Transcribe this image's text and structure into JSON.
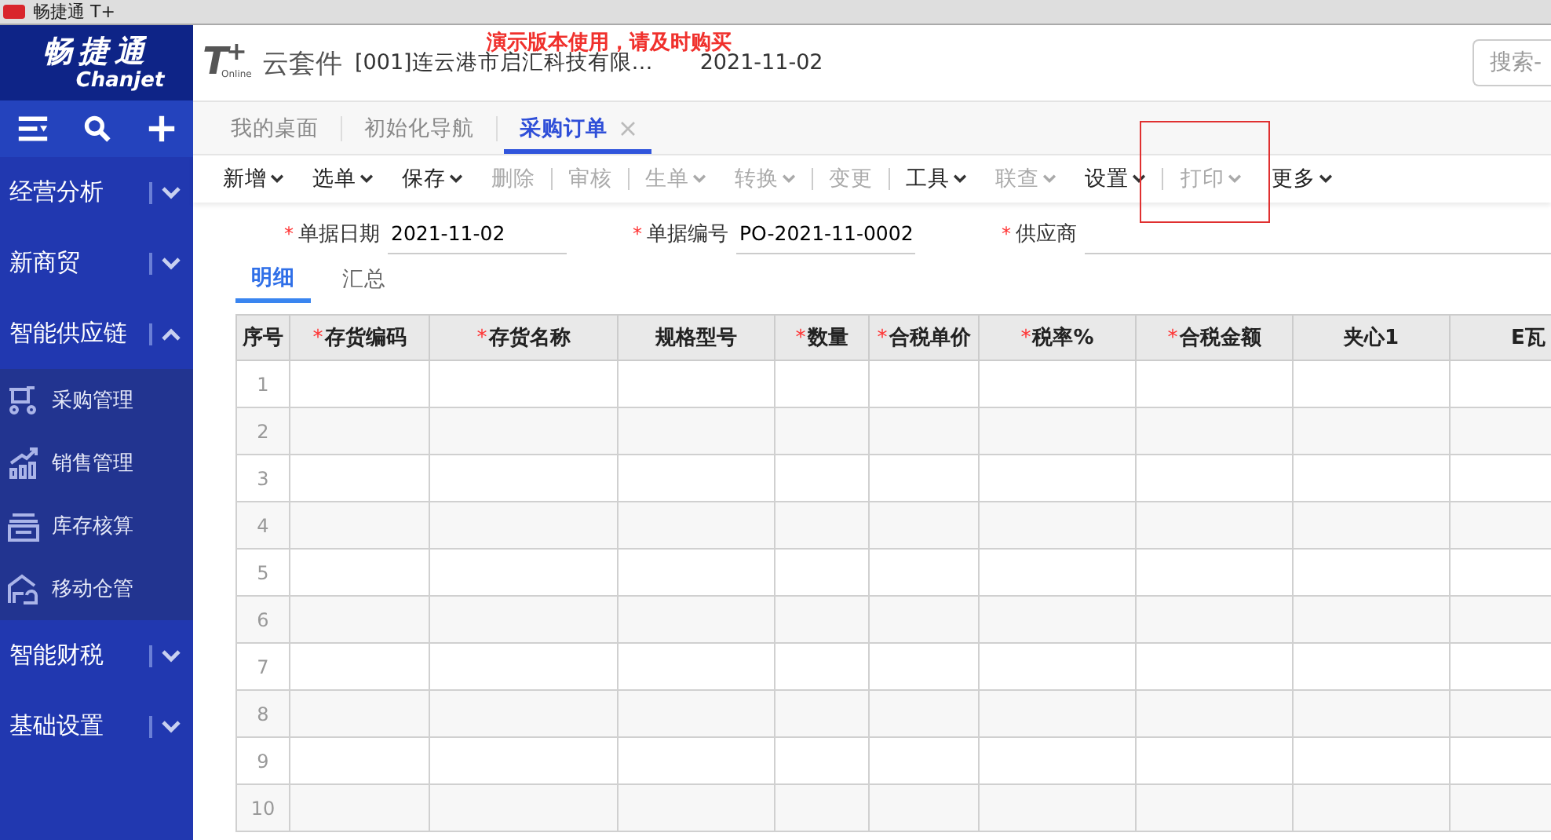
{
  "window": {
    "title": "畅捷通 T+"
  },
  "sidebar": {
    "logo": {
      "name": "畅捷通",
      "sub": "Chanjet"
    },
    "items": [
      {
        "label": "经营分析",
        "expanded": false
      },
      {
        "label": "新商贸",
        "expanded": false
      },
      {
        "label": "智能供应链",
        "expanded": true,
        "children": [
          {
            "label": "采购管理"
          },
          {
            "label": "销售管理"
          },
          {
            "label": "库存核算"
          },
          {
            "label": "移动仓管"
          }
        ]
      },
      {
        "label": "智能财税",
        "expanded": false
      },
      {
        "label": "基础设置",
        "expanded": false
      }
    ]
  },
  "header": {
    "logo": {
      "letter": "T",
      "sign": "+",
      "mark": "Online"
    },
    "product": "云套件",
    "company": "[001]连云港市启汇科技有限…",
    "date": "2021-11-02",
    "notice": "演示版本使用，请及时购买",
    "search": {
      "placeholder": "搜索-"
    }
  },
  "tabs": [
    {
      "label": "我的桌面",
      "selected": false,
      "closable": false
    },
    {
      "label": "初始化导航",
      "selected": false,
      "closable": false
    },
    {
      "label": "采购订单",
      "selected": true,
      "closable": true
    }
  ],
  "toolbar": [
    {
      "label": "新增",
      "disabled": false,
      "dropdown": true,
      "divider_after": false,
      "highlighted": false
    },
    {
      "label": "选单",
      "disabled": false,
      "dropdown": true,
      "divider_after": false,
      "highlighted": false
    },
    {
      "label": "保存",
      "disabled": false,
      "dropdown": true,
      "divider_after": false,
      "highlighted": false
    },
    {
      "label": "删除",
      "disabled": true,
      "dropdown": false,
      "divider_after": true,
      "highlighted": false
    },
    {
      "label": "审核",
      "disabled": true,
      "dropdown": false,
      "divider_after": true,
      "highlighted": false
    },
    {
      "label": "生单",
      "disabled": true,
      "dropdown": true,
      "divider_after": false,
      "highlighted": false
    },
    {
      "label": "转换",
      "disabled": true,
      "dropdown": true,
      "divider_after": true,
      "highlighted": false
    },
    {
      "label": "变更",
      "disabled": true,
      "dropdown": false,
      "divider_after": true,
      "highlighted": false
    },
    {
      "label": "工具",
      "disabled": false,
      "dropdown": true,
      "divider_after": false,
      "highlighted": false
    },
    {
      "label": "联查",
      "disabled": true,
      "dropdown": true,
      "divider_after": false,
      "highlighted": false
    },
    {
      "label": "设置",
      "disabled": false,
      "dropdown": true,
      "divider_after": true,
      "highlighted": false
    },
    {
      "label": "打印",
      "disabled": true,
      "dropdown": true,
      "divider_after": false,
      "highlighted": true
    },
    {
      "label": "更多",
      "disabled": false,
      "dropdown": true,
      "divider_after": false,
      "highlighted": false
    }
  ],
  "required_mark": "*",
  "form": [
    {
      "label": "单据日期",
      "required": true,
      "value": "2021-11-02"
    },
    {
      "label": "单据编号",
      "required": true,
      "value": "PO-2021-11-0002"
    },
    {
      "label": "供应商",
      "required": true
    }
  ],
  "detail_tabs": [
    {
      "label": "明细",
      "selected": true
    },
    {
      "label": "汇总",
      "selected": false
    }
  ],
  "table": {
    "columns": [
      {
        "label": "序号",
        "required": false
      },
      {
        "label": "存货编码",
        "required": true
      },
      {
        "label": "存货名称",
        "required": true
      },
      {
        "label": "规格型号",
        "required": false
      },
      {
        "label": "数量",
        "required": true
      },
      {
        "label": "合税单价",
        "required": true
      },
      {
        "label": "税率%",
        "required": true
      },
      {
        "label": "合税金额",
        "required": true
      },
      {
        "label": "夹心1",
        "required": false
      },
      {
        "label": "E瓦",
        "required": false
      }
    ],
    "rows": [
      "1",
      "2",
      "3",
      "4",
      "5",
      "6",
      "7",
      "8",
      "9",
      "10"
    ]
  }
}
